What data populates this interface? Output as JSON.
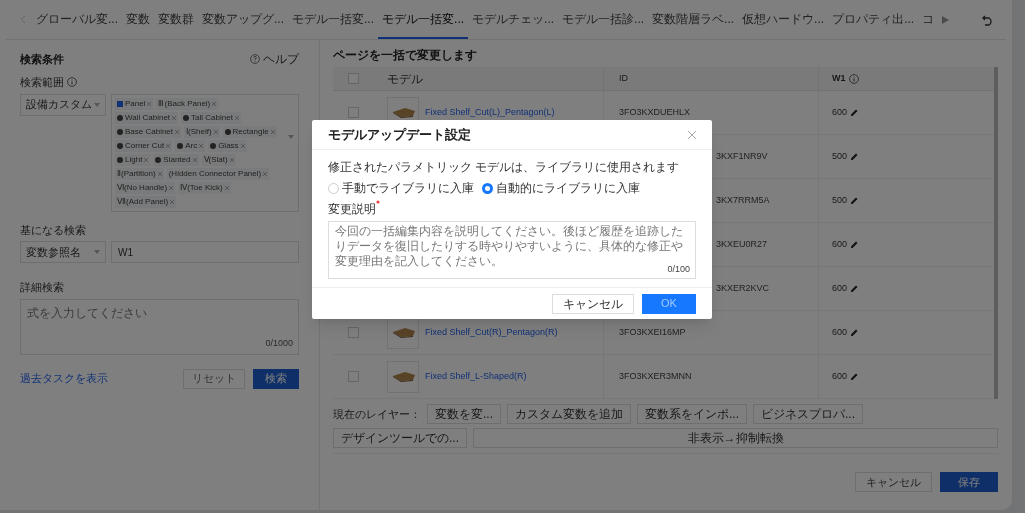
{
  "tabs": [
    {
      "label": "グローバル変...",
      "selected": false
    },
    {
      "label": "変数",
      "selected": false
    },
    {
      "label": "変数群",
      "selected": false
    },
    {
      "label": "変数アップグ...",
      "selected": false
    },
    {
      "label": "モデル一括変...",
      "selected": false
    },
    {
      "label": "モデル一括変...",
      "selected": true
    },
    {
      "label": "モデルチェッ...",
      "selected": false
    },
    {
      "label": "モデル一括診...",
      "selected": false
    },
    {
      "label": "変数階層ラベ...",
      "selected": false
    },
    {
      "label": "仮想ハードウ...",
      "selected": false
    },
    {
      "label": "プロパティ出...",
      "selected": false
    },
    {
      "label": "コ",
      "selected": false
    }
  ],
  "search": {
    "title": "検索条件",
    "help": "ヘルプ",
    "scope_label": "検索範囲",
    "scope_select": "設備カスタム",
    "tags": [
      {
        "label": "Panel",
        "kind": "check"
      },
      {
        "label": "Ⅲ(Back Panel)",
        "kind": "plain"
      },
      {
        "label": "Wall Cabinet",
        "kind": "dot"
      },
      {
        "label": "Tall Cabinet",
        "kind": "dot"
      },
      {
        "label": "Base Cabinet",
        "kind": "dot"
      },
      {
        "label": "Ⅰ(Shelf)",
        "kind": "plain"
      },
      {
        "label": "Rectangle",
        "kind": "dot"
      },
      {
        "label": "Corner Cut",
        "kind": "dot"
      },
      {
        "label": "Arc",
        "kind": "dot"
      },
      {
        "label": "Glass",
        "kind": "dot"
      },
      {
        "label": "Light",
        "kind": "dot"
      },
      {
        "label": "Slanted",
        "kind": "dot"
      },
      {
        "label": "Ⅴ(Slat)",
        "kind": "plain"
      },
      {
        "label": "Ⅱ(Partition)",
        "kind": "plain"
      },
      {
        "label": "(Hidden Connector Panel)",
        "kind": "plain"
      },
      {
        "label": "Ⅵ(No Handle)",
        "kind": "plain"
      },
      {
        "label": "Ⅳ(Toe Kick)",
        "kind": "plain"
      },
      {
        "label": "Ⅶ(Add Panel)",
        "kind": "plain"
      }
    ],
    "base_label": "基になる検索",
    "base_select": "変数参照名",
    "base_value": "W1",
    "detail_label": "詳細検索",
    "detail_placeholder": "式を入力してください",
    "detail_count": "0/1000",
    "history_link": "過去タスクを表示",
    "reset": "リセット",
    "submit": "検索"
  },
  "table": {
    "title": "ページを一括で変更します",
    "columns": [
      "モデル",
      "ID",
      "W1"
    ],
    "all_checked": false,
    "rows": [
      {
        "checked": false,
        "model": "Fixed Shelf_Cut(L)_Pentagon(L)",
        "id": "3FO3KXDUEHLX",
        "w1": "600"
      },
      {
        "id": "3KXF1NR9V",
        "w1": "500"
      },
      {
        "id": "3KX7RRM5A",
        "w1": "500"
      },
      {
        "id": "3KXEU0R27",
        "w1": "600"
      },
      {
        "id": "3KXER2KVC",
        "w1": "600"
      },
      {
        "checked": false,
        "model": "Fixed Shelf_Cut(R)_Pentagon(R)",
        "id": "3FO3KXEI16MP",
        "w1": "600"
      },
      {
        "checked": false,
        "model": "Fixed Shelf_L-Shaped(R)",
        "id": "3FO3KXER3MNN",
        "w1": "600"
      }
    ]
  },
  "toolbar": {
    "label": "現在のレイヤー：",
    "buttons": [
      "変数を変...",
      "カスタム変数を追加",
      "変数系をインポ...",
      "ビジネスプロパ...",
      "デザインツールでの...",
      "非表示→抑制転換"
    ]
  },
  "footer": {
    "cancel": "キャンセル",
    "save": "保存"
  },
  "dialog": {
    "title": "モデルアップデート設定",
    "note": "修正されたパラメトリック モデルは、ライブラリに使用されます",
    "options": [
      {
        "label": "手動でライブラリに入庫",
        "selected": false
      },
      {
        "label": "自動的にライブラリに入庫",
        "selected": true
      }
    ],
    "field_label": "変更説明",
    "required": true,
    "placeholder": "今回の一括編集内容を説明してください。後ほど履歴を追跡したりデータを復旧したりする時やりやすいように、具体的な修正や変更理由を記入してください。",
    "count": "0/100",
    "cancel": "キャンセル",
    "ok": "OK"
  }
}
